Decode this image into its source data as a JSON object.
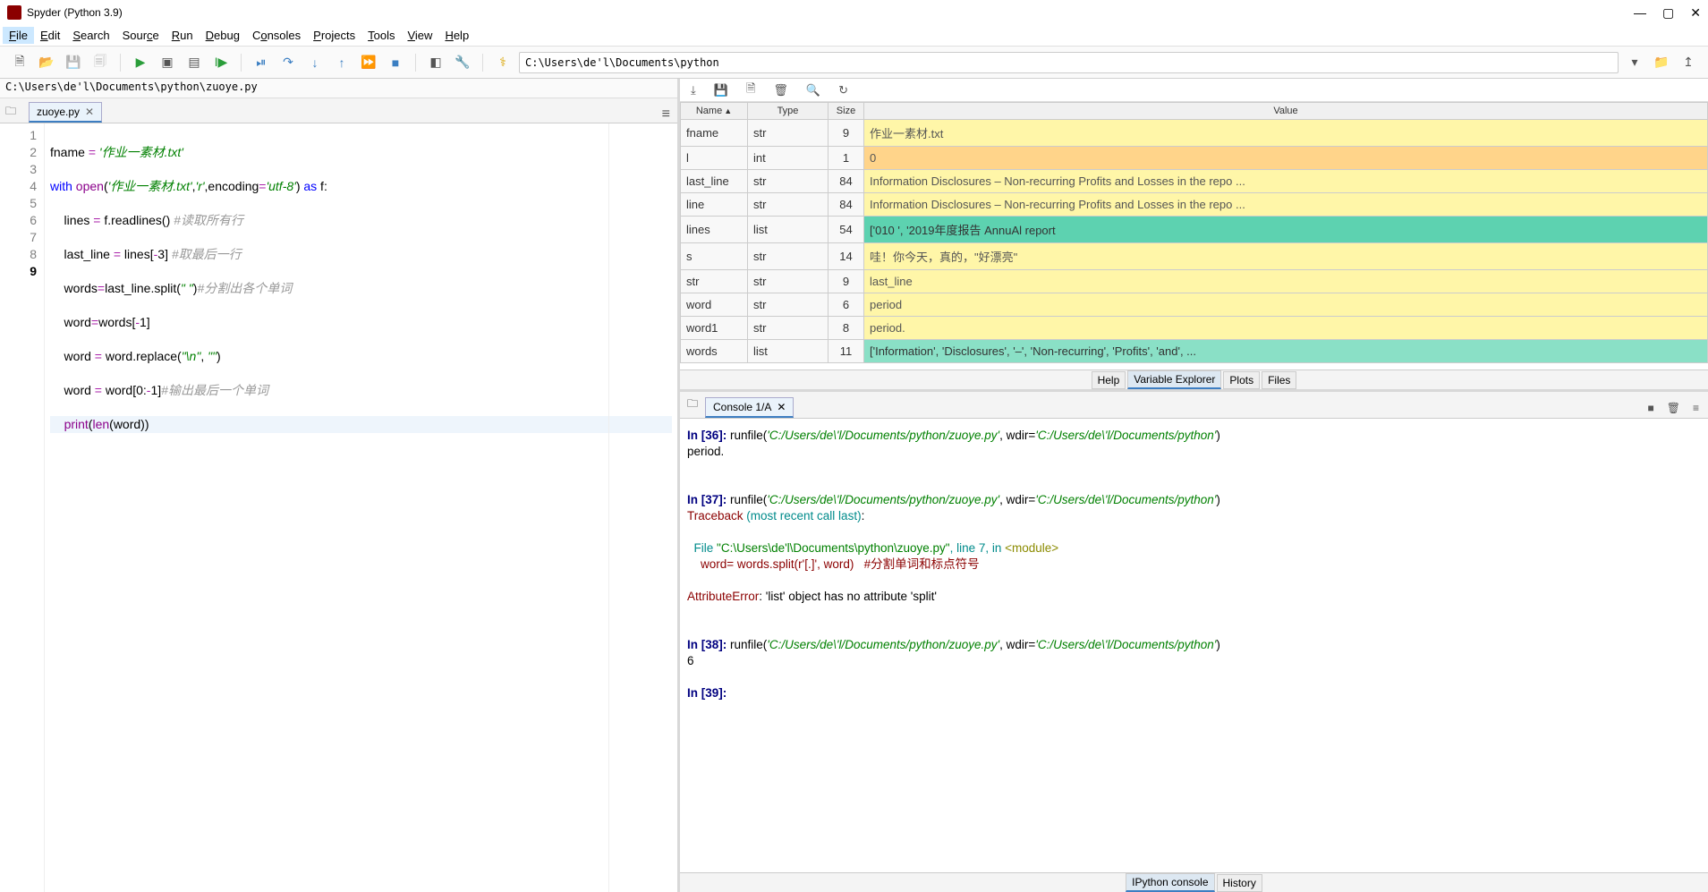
{
  "window": {
    "title": "Spyder (Python 3.9)"
  },
  "menu": [
    "File",
    "Edit",
    "Search",
    "Source",
    "Run",
    "Debug",
    "Consoles",
    "Projects",
    "Tools",
    "View",
    "Help"
  ],
  "toolbar": {
    "working_dir": "C:\\Users\\de'l\\Documents\\python"
  },
  "editor": {
    "filepath": "C:\\Users\\de'l\\Documents\\python\\zuoye.py",
    "tab": "zuoye.py",
    "current_line": 9,
    "code": [
      {
        "n": 1,
        "raw": "fname = '作业一素材.txt'"
      },
      {
        "n": 2,
        "raw": "with open('作业一素材.txt','r',encoding='utf-8') as f:"
      },
      {
        "n": 3,
        "raw": "    lines = f.readlines() #读取所有行"
      },
      {
        "n": 4,
        "raw": "    last_line = lines[-3] #取最后一行"
      },
      {
        "n": 5,
        "raw": "    words=last_line.split(\" \")#分割出各个单词"
      },
      {
        "n": 6,
        "raw": "    word=words[-1]"
      },
      {
        "n": 7,
        "raw": "    word = word.replace(\"\\n\", \"\")"
      },
      {
        "n": 8,
        "raw": "    word = word[0:-1]#输出最后一个单词"
      },
      {
        "n": 9,
        "raw": "    print(len(word))"
      }
    ]
  },
  "variable_explorer": {
    "headers": {
      "name": "Name",
      "type": "Type",
      "size": "Size",
      "value": "Value"
    },
    "rows": [
      {
        "name": "fname",
        "type": "str",
        "size": "9",
        "value": "作业一素材.txt",
        "cls": "c-yellow"
      },
      {
        "name": "l",
        "type": "int",
        "size": "1",
        "value": "0",
        "cls": "c-orange"
      },
      {
        "name": "last_line",
        "type": "str",
        "size": "84",
        "value": "Information Disclosures – Non-recurring Profits and Losses in the repo ...",
        "cls": "c-yellow"
      },
      {
        "name": "line",
        "type": "str",
        "size": "84",
        "value": "Information Disclosures – Non-recurring Profits and Losses in the repo ...",
        "cls": "c-yellow"
      },
      {
        "name": "lines",
        "type": "list",
        "size": "54",
        "value": "['010\n', '2019年度报告 AnnuAl report",
        "cls": "c-teal"
      },
      {
        "name": "s",
        "type": "str",
        "size": "14",
        "value": "哇！你今天，真的，\"好漂亮\"",
        "cls": "c-yellow"
      },
      {
        "name": "str",
        "type": "str",
        "size": "9",
        "value": "last_line",
        "cls": "c-yellow"
      },
      {
        "name": "word",
        "type": "str",
        "size": "6",
        "value": "period",
        "cls": "c-yellow"
      },
      {
        "name": "word1",
        "type": "str",
        "size": "8",
        "value": "period.",
        "cls": "c-yellow"
      },
      {
        "name": "words",
        "type": "list",
        "size": "11",
        "value": "['Information', 'Disclosures', '–', 'Non-recurring', 'Profits', 'and', ...",
        "cls": "c-teal2"
      }
    ],
    "tabs": [
      "Help",
      "Variable Explorer",
      "Plots",
      "Files"
    ]
  },
  "console": {
    "tab": "Console 1/A",
    "lines": {
      "in36": "In [36]:",
      "runfile": " runfile(",
      "path": "'C:/Users/de\\'l/Documents/python/zuoye.py'",
      "wdir": ", wdir=",
      "wdirpath": "'C:/Users/de\\'l/Documents/python'",
      "rparen": ")",
      "out36": "period.",
      "in37": "In [37]:",
      "traceback": "Traceback ",
      "recent": "(most recent call last)",
      "colon": ":",
      "file": "  File ",
      "filepath": "\"C:\\Users\\de'l\\Documents\\python\\zuoye.py\"",
      "linelab": ", line 7, ",
      "inword": "in ",
      "module": "<module>",
      "errline": "    word= words.split(r'[.]', word)   #分割单词和标点符号",
      "attrerr_name": "AttributeError",
      "attrerr_msg": ": 'list' object has no attribute 'split'",
      "in38": "In [38]:",
      "out38": "6",
      "in39": "In [39]: "
    },
    "bottom_tabs": [
      "IPython console",
      "History"
    ]
  }
}
